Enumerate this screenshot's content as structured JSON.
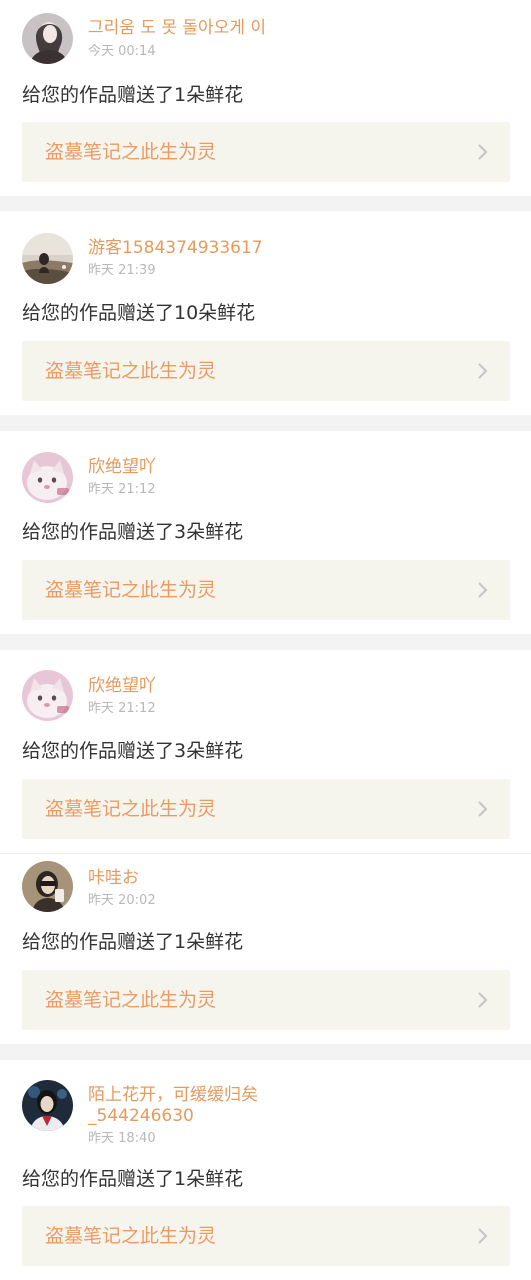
{
  "notifications": [
    {
      "user_name": "그리움 도 못 돌아오게 이",
      "time": "今天 00:14",
      "message": "给您的作品赠送了1朵鲜花",
      "work_title": "盗墓笔记之此生为灵",
      "avatar_icon": "avatar-photo-icon"
    },
    {
      "user_name": "游客1584374933617",
      "time": "昨天 21:39",
      "message": "给您的作品赠送了10朵鲜花",
      "work_title": "盗墓笔记之此生为灵",
      "avatar_icon": "avatar-photo-icon"
    },
    {
      "user_name": "欣绝望吖",
      "time": "昨天 21:12",
      "message": "给您的作品赠送了3朵鲜花",
      "work_title": "盗墓笔记之此生为灵",
      "avatar_icon": "avatar-cat-icon"
    },
    {
      "user_name": "欣绝望吖",
      "time": "昨天 21:12",
      "message": "给您的作品赠送了3朵鲜花",
      "work_title": "盗墓笔记之此生为灵",
      "avatar_icon": "avatar-cat-icon"
    },
    {
      "user_name": "咔哇お",
      "time": "昨天 20:02",
      "message": "给您的作品赠送了1朵鲜花",
      "work_title": "盗墓笔记之此生为灵",
      "avatar_icon": "avatar-photo-icon"
    },
    {
      "user_name": "陌上花开，可缓缓归矣\n_544246630",
      "time": "昨天 18:40",
      "message": "给您的作品赠送了1朵鲜花",
      "work_title": "盗墓笔记之此生为灵",
      "avatar_icon": "avatar-photo-icon"
    }
  ],
  "colors": {
    "user_name": "#e69a5e",
    "work_title": "#ec9a63",
    "time": "#b8b8b8",
    "message": "#333333",
    "work_link_background": "#f5f5ee",
    "page_background": "#f3f3f3"
  },
  "icons": {
    "work_link": "chevron-right-icon"
  }
}
